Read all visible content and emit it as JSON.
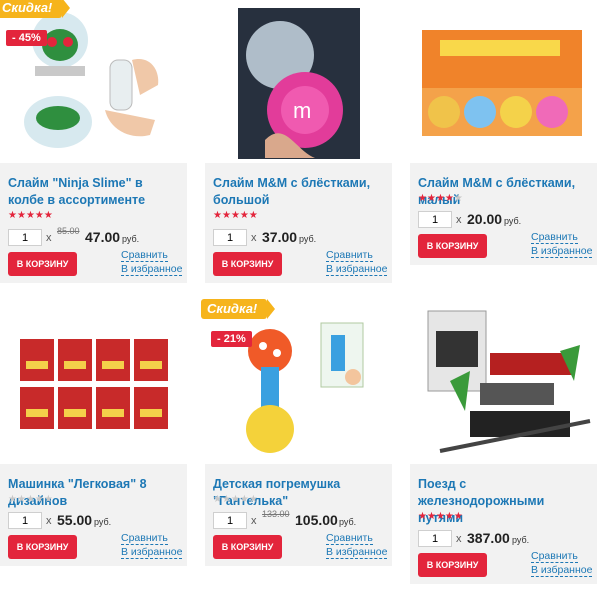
{
  "products": [
    {
      "title": "Слайм \"Ninja Slime\" в колбе в ассортименте",
      "badge": "Скидка!",
      "discount": "- 45%",
      "rating": 5,
      "qty": "1",
      "old_price": "85.00",
      "price": "47.00",
      "currency": "руб.",
      "button": "В КОРЗИНУ",
      "compare": "Сравнить",
      "favorite": "В избранное"
    },
    {
      "title": "Слайм M&M с блёстками, большой",
      "rating": 5,
      "qty": "1",
      "price": "37.00",
      "currency": "руб.",
      "button": "В КОРЗИНУ",
      "compare": "Сравнить",
      "favorite": "В избранное"
    },
    {
      "title": "Слайм M&M с блёстками, малый",
      "rating": 4,
      "qty": "1",
      "price": "20.00",
      "currency": "руб.",
      "button": "В КОРЗИНУ",
      "compare": "Сравнить",
      "favorite": "В избранное"
    },
    {
      "title": "Машинка \"Легковая\" 8 дизайнов",
      "rating": 0,
      "qty": "1",
      "price": "55.00",
      "currency": "руб.",
      "button": "В КОРЗИНУ",
      "compare": "Сравнить",
      "favorite": "В избранное"
    },
    {
      "title": "Детская погремушка \"Гантелька\"",
      "badge": "Скидка!",
      "discount": "- 21%",
      "rating": 0,
      "qty": "1",
      "old_price": "133.00",
      "price": "105.00",
      "currency": "руб.",
      "button": "В КОРЗИНУ",
      "compare": "Сравнить",
      "favorite": "В избранное"
    },
    {
      "title": "Поезд с железнодорожными путями",
      "rating": 4.5,
      "qty": "1",
      "price": "387.00",
      "currency": "руб.",
      "button": "В КОРЗИНУ",
      "compare": "Сравнить",
      "favorite": "В избранное"
    }
  ],
  "colors": {
    "accent": "#e3253c",
    "link": "#1d78b5",
    "badge": "#f6b41c"
  }
}
